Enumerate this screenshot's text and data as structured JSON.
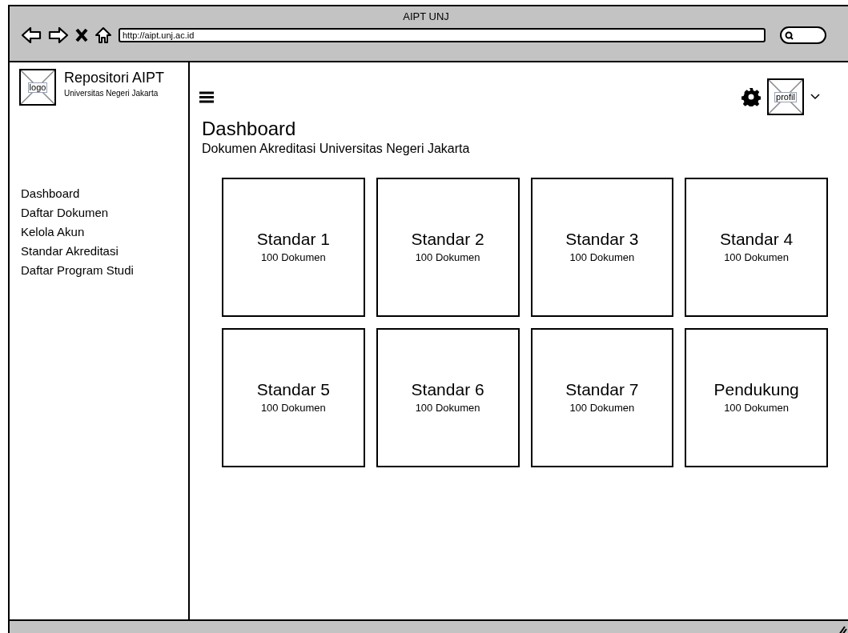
{
  "window": {
    "title": "AIPT UNJ",
    "url": "http://aipt.unj.ac.id"
  },
  "sidebar": {
    "logo": "logo",
    "brand": "Repositori AIPT",
    "subtitle": "Universitas Negeri Jakarta",
    "items": [
      {
        "label": "Dashboard"
      },
      {
        "label": "Daftar Dokumen"
      },
      {
        "label": "Kelola Akun"
      },
      {
        "label": "Standar Akreditasi"
      },
      {
        "label": "Daftar Program Studi"
      }
    ]
  },
  "header": {
    "profile": "profil"
  },
  "page": {
    "title": "Dashboard",
    "subtitle": "Dokumen Akreditasi Universitas Negeri Jakarta"
  },
  "cards": [
    {
      "title": "Standar 1",
      "count": "100 Dokumen"
    },
    {
      "title": "Standar 2",
      "count": "100 Dokumen"
    },
    {
      "title": "Standar 3",
      "count": "100 Dokumen"
    },
    {
      "title": "Standar 4",
      "count": "100 Dokumen"
    },
    {
      "title": "Standar 5",
      "count": "100 Dokumen"
    },
    {
      "title": "Standar 6",
      "count": "100 Dokumen"
    },
    {
      "title": "Standar 7",
      "count": "100 Dokumen"
    },
    {
      "title": "Pendukung",
      "count": "100 Dokumen"
    }
  ]
}
